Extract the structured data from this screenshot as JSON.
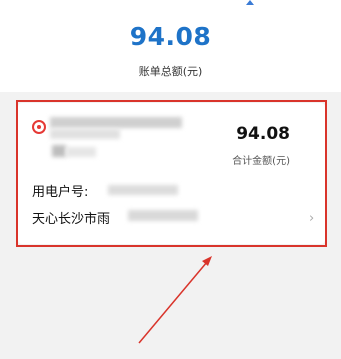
{
  "summary": {
    "total_amount": "94.08",
    "total_label": "账单总额(元)"
  },
  "bill_card": {
    "amount": "94.08",
    "amount_label": "合计金额(元)",
    "account_label": "用电户号:",
    "org_name": "天心长沙市雨",
    "logo_icon": "state-grid-logo-icon",
    "chevron_icon": "chevron-right-icon"
  },
  "colors": {
    "accent_blue": "#1e73c8",
    "highlight_red": "#d9342b",
    "logo_red": "#e53935"
  }
}
